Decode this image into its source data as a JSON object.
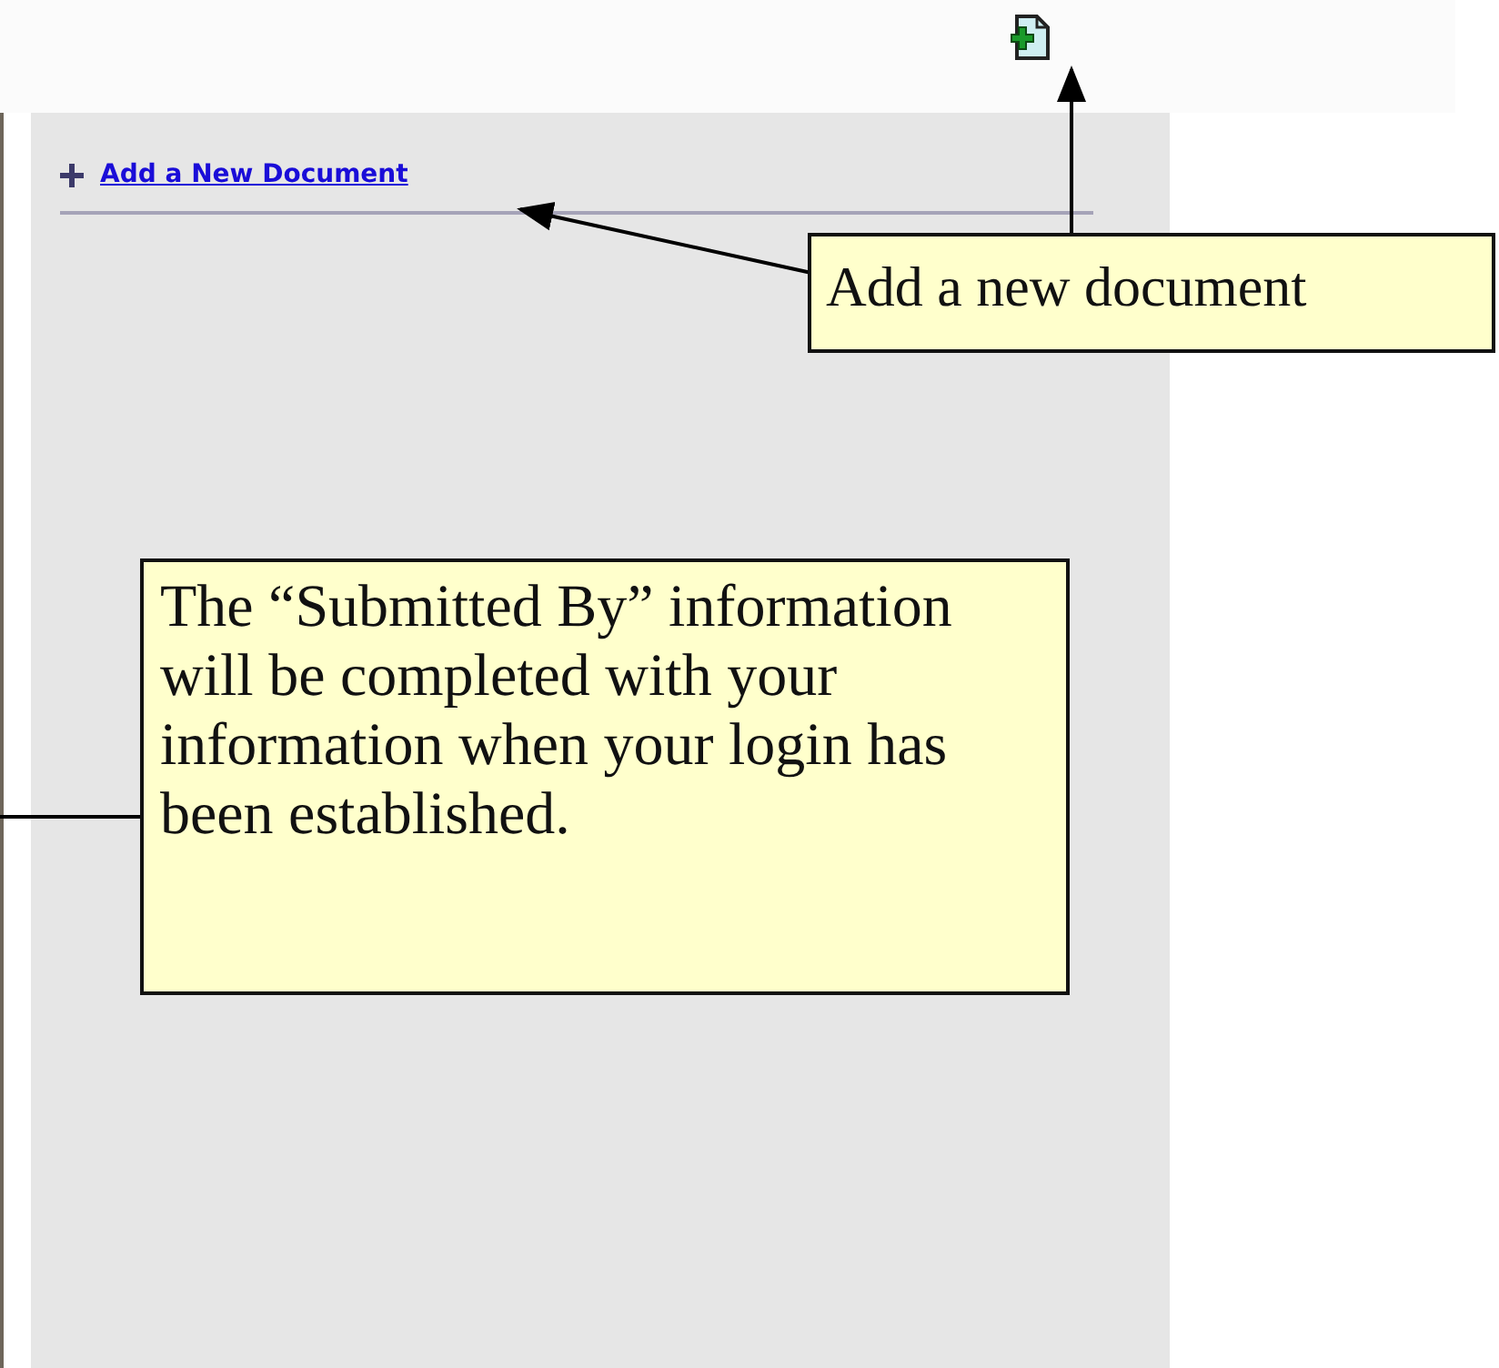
{
  "panel": {
    "add_link": "Add a New Document"
  },
  "callouts": [
    {
      "kind": "top",
      "text": "Add a new document"
    },
    {
      "kind": "side",
      "text": "The “Submitted By” information will be completed with your information when your login has been established."
    }
  ]
}
